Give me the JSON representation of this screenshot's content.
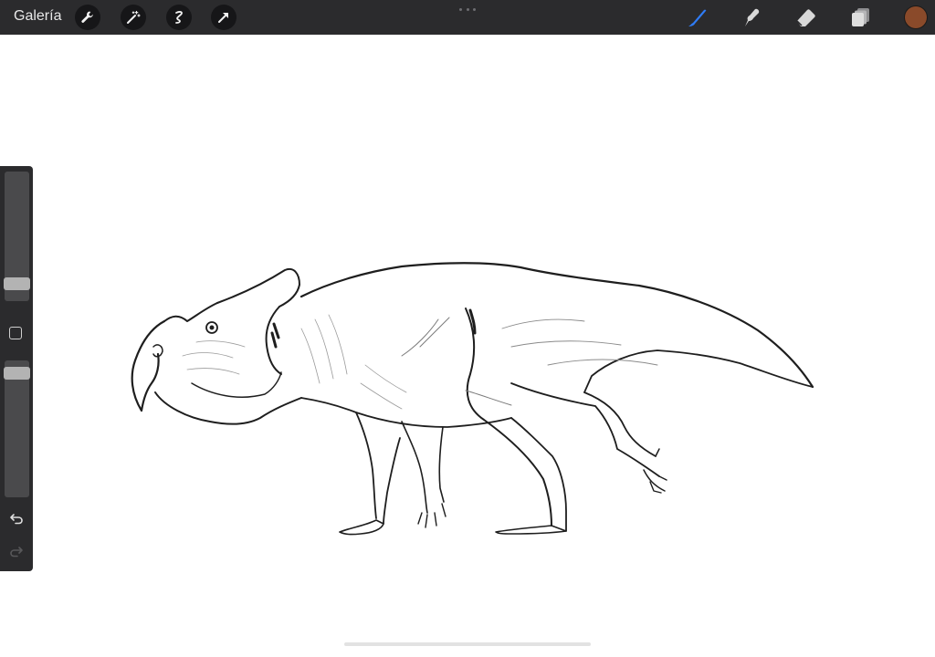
{
  "topbar": {
    "gallery_label": "Galería",
    "left_tools": [
      "wrench-icon",
      "magic-wand-icon",
      "selection-icon",
      "transform-arrow-icon"
    ],
    "right_tools": [
      "brush-icon",
      "smudge-icon",
      "eraser-icon",
      "layers-icon"
    ],
    "active_tool": "brush-icon",
    "current_color": "#8a4a2a",
    "accent_color": "#2f7cf6"
  },
  "sidebar": {
    "brush_size_level": 0.16,
    "opacity_level": 0.95,
    "modify_button": "square-icon",
    "undo": "undo-icon",
    "redo": "redo-icon"
  },
  "canvas": {
    "content": "sketch-illustration"
  }
}
